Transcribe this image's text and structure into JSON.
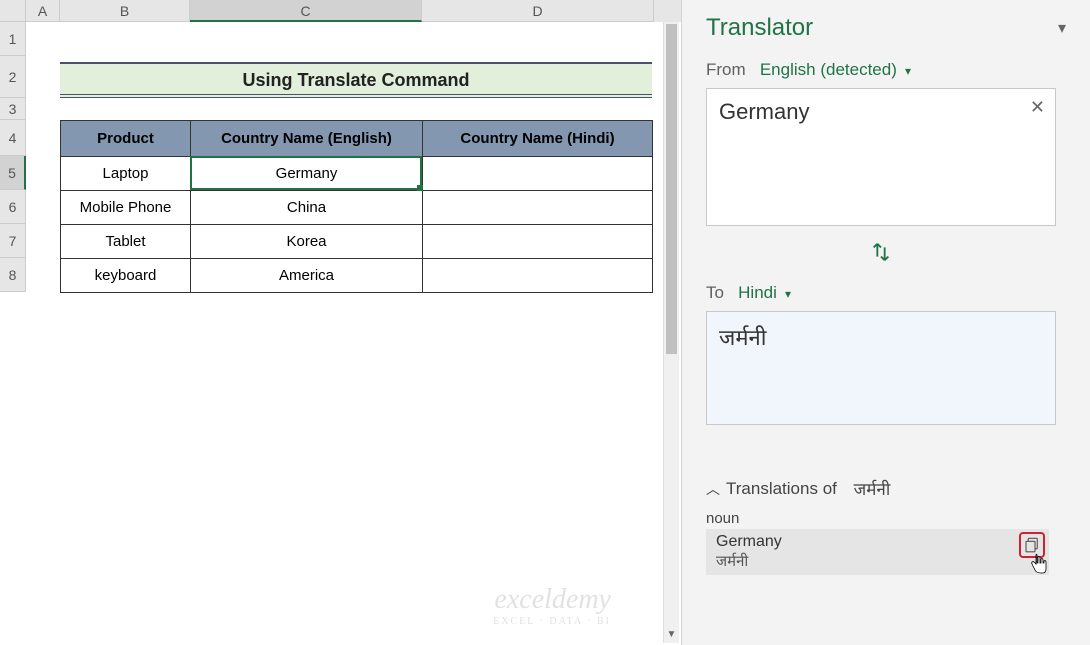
{
  "columns": {
    "A": "A",
    "B": "B",
    "C": "C",
    "D": "D"
  },
  "rows": [
    "1",
    "2",
    "3",
    "4",
    "5",
    "6",
    "7",
    "8"
  ],
  "title_banner": "Using Translate Command",
  "table": {
    "headers": {
      "product": "Product",
      "english": "Country Name (English)",
      "hindi": "Country Name (Hindi)"
    },
    "rows": [
      {
        "product": "Laptop",
        "english": "Germany",
        "hindi": ""
      },
      {
        "product": "Mobile Phone",
        "english": "China",
        "hindi": ""
      },
      {
        "product": "Tablet",
        "english": "Korea",
        "hindi": ""
      },
      {
        "product": "keyboard",
        "english": "America",
        "hindi": ""
      }
    ]
  },
  "watermark": {
    "main": "exceldemy",
    "sub": "EXCEL · DATA · BI"
  },
  "translator": {
    "pane_title": "Translator",
    "from_label": "From",
    "from_lang": "English (detected)",
    "source_text": "Germany",
    "to_label": "To",
    "to_lang": "Hindi",
    "translated_text": "जर्मनी",
    "translations_label": "Translations of",
    "translations_of_word": "जर्मनी",
    "part_of_speech": "noun",
    "suggestion_word": "Germany",
    "suggestion_sub": "जर्मनी"
  }
}
